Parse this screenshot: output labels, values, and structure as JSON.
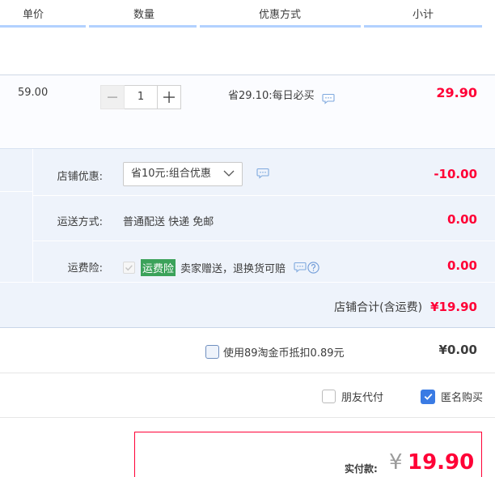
{
  "header": {
    "col_price": "单价",
    "col_qty": "数量",
    "col_promo": "优惠方式",
    "col_subtotal": "小计"
  },
  "item": {
    "price": "59.00",
    "quantity": "1",
    "promo_text": "省29.10:每日必买",
    "subtotal": "29.90"
  },
  "shop": {
    "discount_label": "店铺优惠:",
    "discount_select": "省10元:组合优惠",
    "discount_value": "-10.00",
    "shipping_label": "运送方式:",
    "shipping_text": "普通配送 快递 免邮",
    "shipping_value": "0.00",
    "insurance_label": "运费险:",
    "insurance_tag": "运费险",
    "insurance_text": "卖家赠送，退换货可赔",
    "insurance_value": "0.00",
    "total_label": "店铺合计(含运费)",
    "total_value": "¥19.90"
  },
  "coins": {
    "label": "使用89淘金币抵扣0.89元",
    "checked": false,
    "value": "¥0.00"
  },
  "options": {
    "friend_pay_label": "朋友代付",
    "friend_pay_checked": false,
    "anonymous_label": "匿名购买",
    "anonymous_checked": true
  },
  "payment": {
    "label": "实付款:",
    "currency": "¥",
    "amount": "19.90"
  },
  "colors": {
    "accent_red": "#ff0036",
    "header_line": "#b2d1ff",
    "shop_bg": "#eef3fb",
    "checkbox_blue": "#3a7be4",
    "tag_green": "#3ba25a"
  }
}
